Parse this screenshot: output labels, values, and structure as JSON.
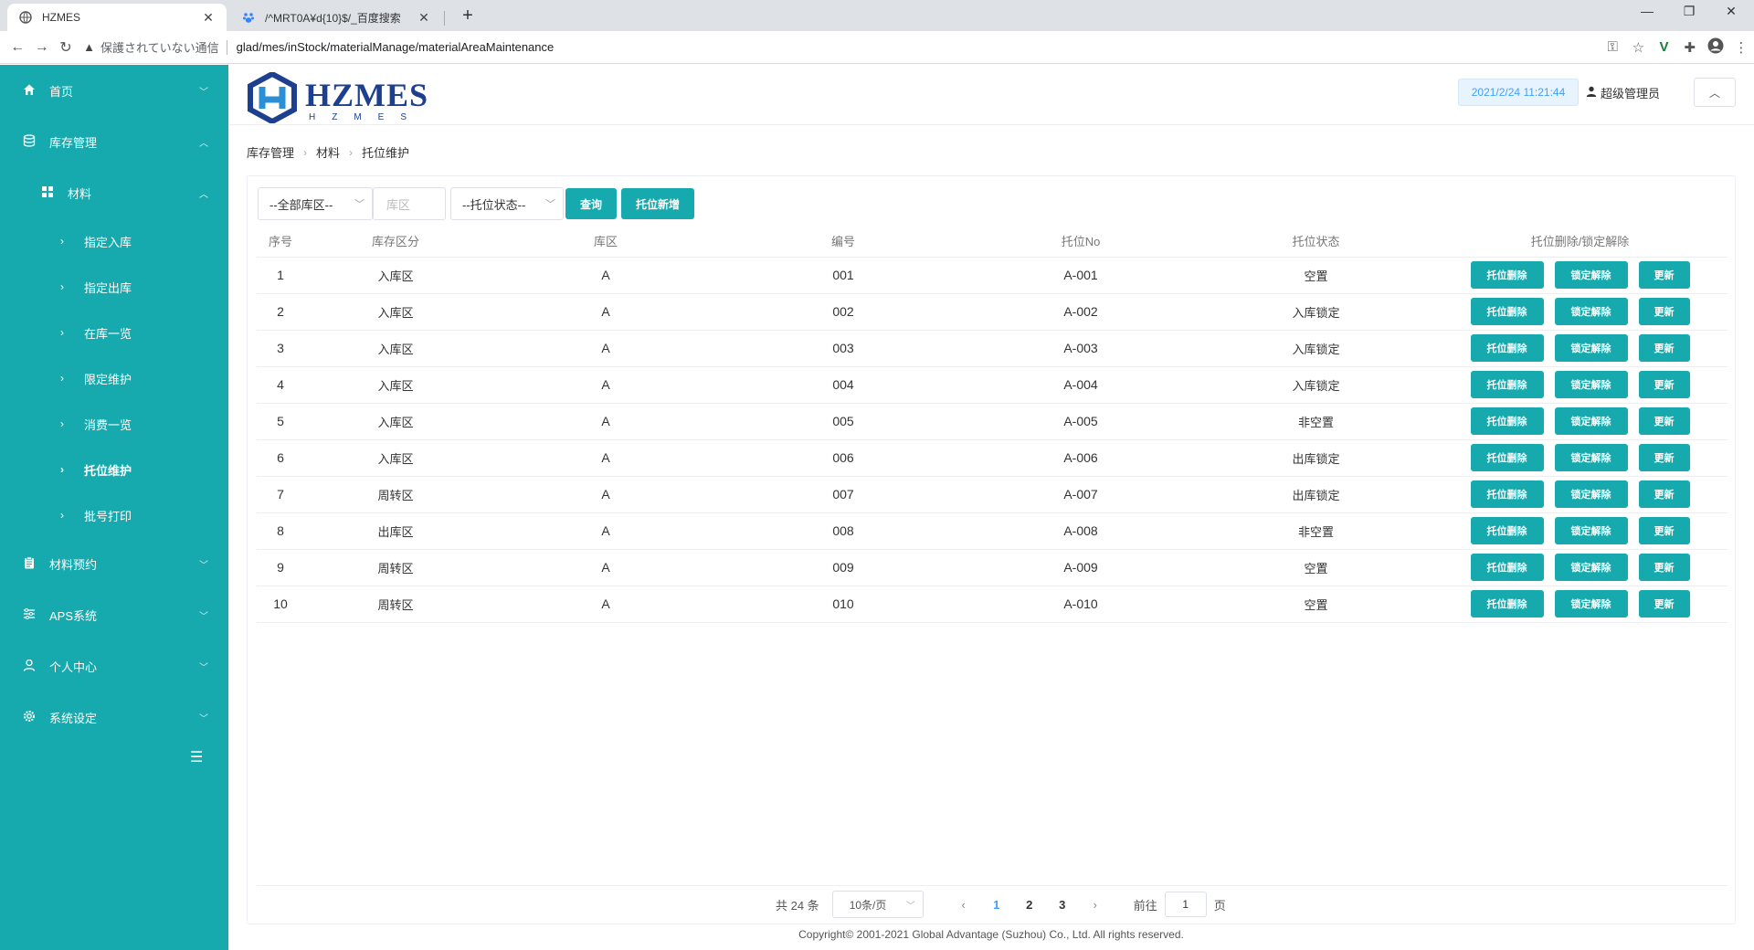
{
  "browser": {
    "tabs": [
      {
        "title": "HZMES",
        "icon": "globe-icon"
      },
      {
        "title": "/^MRT0A¥d{10}$/_百度搜索",
        "icon": "baidu-paw-icon"
      }
    ],
    "new_tab": "+",
    "insecure_label": "保護されていない通信",
    "url": "glad/mes/inStock/materialManage/materialAreaMaintenance"
  },
  "sidebar": {
    "items": [
      {
        "label": "首页",
        "icon": "home-icon"
      },
      {
        "label": "库存管理",
        "icon": "database-icon"
      },
      {
        "label": "材料预约",
        "icon": "clipboard-icon"
      },
      {
        "label": "APS系统",
        "icon": "sliders-icon"
      },
      {
        "label": "个人中心",
        "icon": "user-icon"
      },
      {
        "label": "系统设定",
        "icon": "gear-icon"
      }
    ],
    "sub": {
      "label": "材料",
      "icon": "grid-icon"
    },
    "leaves": [
      "指定入库",
      "指定出库",
      "在库一览",
      "限定维护",
      "消费一览",
      "托位维护",
      "批号打印"
    ],
    "active_leaf": "托位维护"
  },
  "header": {
    "brand": "HZMES",
    "brand_sub": "HZMES",
    "datetime": "2021/2/24 11:21:44",
    "user": "超级管理员"
  },
  "breadcrumb": [
    "库存管理",
    "材料",
    "托位维护"
  ],
  "filters": {
    "area_select": "--全部库区--",
    "zone_placeholder": "库区",
    "status_select": "--托位状态--",
    "query_label": "查询",
    "add_label": "托位新增"
  },
  "table": {
    "headers": [
      "序号",
      "库存区分",
      "库区",
      "编号",
      "托位No",
      "托位状态",
      "托位删除/锁定解除"
    ],
    "rows": [
      {
        "no": "1",
        "type": "入库区",
        "zone": "A",
        "code": "001",
        "pallet": "A-001",
        "status": "空置"
      },
      {
        "no": "2",
        "type": "入库区",
        "zone": "A",
        "code": "002",
        "pallet": "A-002",
        "status": "入库锁定"
      },
      {
        "no": "3",
        "type": "入库区",
        "zone": "A",
        "code": "003",
        "pallet": "A-003",
        "status": "入库锁定"
      },
      {
        "no": "4",
        "type": "入库区",
        "zone": "A",
        "code": "004",
        "pallet": "A-004",
        "status": "入库锁定"
      },
      {
        "no": "5",
        "type": "入库区",
        "zone": "A",
        "code": "005",
        "pallet": "A-005",
        "status": "非空置"
      },
      {
        "no": "6",
        "type": "入库区",
        "zone": "A",
        "code": "006",
        "pallet": "A-006",
        "status": "出库锁定"
      },
      {
        "no": "7",
        "type": "周转区",
        "zone": "A",
        "code": "007",
        "pallet": "A-007",
        "status": "出库锁定"
      },
      {
        "no": "8",
        "type": "出库区",
        "zone": "A",
        "code": "008",
        "pallet": "A-008",
        "status": "非空置"
      },
      {
        "no": "9",
        "type": "周转区",
        "zone": "A",
        "code": "009",
        "pallet": "A-009",
        "status": "空置"
      },
      {
        "no": "10",
        "type": "周转区",
        "zone": "A",
        "code": "010",
        "pallet": "A-010",
        "status": "空置"
      }
    ],
    "actions": [
      "托位删除",
      "锁定解除",
      "更新"
    ]
  },
  "pagination": {
    "total": "共 24 条",
    "page_size": "10条/页",
    "pages": [
      "1",
      "2",
      "3"
    ],
    "current": "1",
    "goto_label": "前往",
    "goto_value": "1",
    "page_unit": "页"
  },
  "footer": "Copyright© 2001-2021 Global Advantage (Suzhou) Co., Ltd. All rights reserved.",
  "colors": {
    "accent": "#16aaae",
    "link": "#409eff"
  }
}
